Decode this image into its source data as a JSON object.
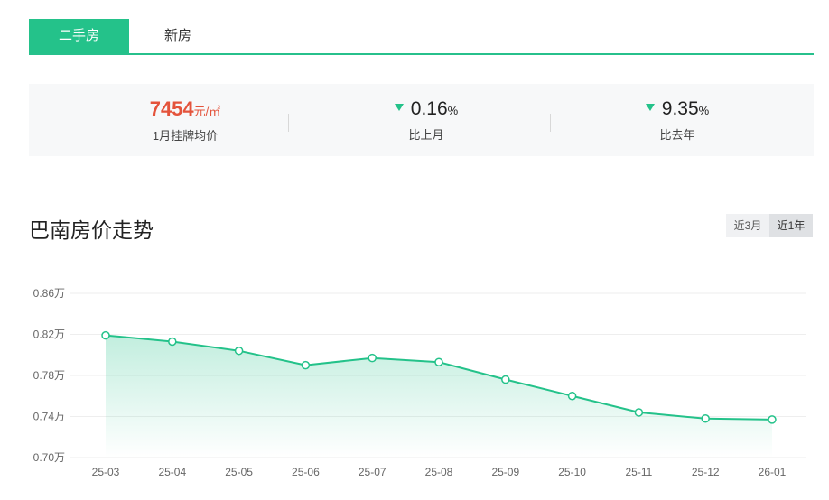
{
  "tabs": [
    {
      "label": "二手房",
      "active": true
    },
    {
      "label": "新房",
      "active": false
    }
  ],
  "stats": {
    "price": {
      "value": "7454",
      "unit": "元/㎡",
      "label": "1月挂牌均价"
    },
    "mom": {
      "value": "0.16",
      "unit": "%",
      "label": "比上月",
      "direction": "down"
    },
    "yoy": {
      "value": "9.35",
      "unit": "%",
      "label": "比去年",
      "direction": "down"
    }
  },
  "section_title": "巴南房价走势",
  "range_buttons": [
    {
      "label": "近3月",
      "active": false
    },
    {
      "label": "近1年",
      "active": true
    }
  ],
  "colors": {
    "accent": "#24c28a",
    "price": "#e4533b"
  },
  "chart_data": {
    "type": "area",
    "title": "巴南房价走势",
    "categories": [
      "25-03",
      "25-04",
      "25-05",
      "25-06",
      "25-07",
      "25-08",
      "25-09",
      "25-10",
      "25-11",
      "25-12",
      "26-01"
    ],
    "values": [
      0.819,
      0.813,
      0.804,
      0.79,
      0.797,
      0.793,
      0.776,
      0.76,
      0.744,
      0.738,
      0.737
    ],
    "yticks": [
      0.7,
      0.74,
      0.78,
      0.82,
      0.86
    ],
    "ytick_labels": [
      "0.70万",
      "0.74万",
      "0.78万",
      "0.82万",
      "0.86万"
    ],
    "ylim": [
      0.7,
      0.86
    ],
    "grid": true,
    "line_color": "#24c28a"
  }
}
